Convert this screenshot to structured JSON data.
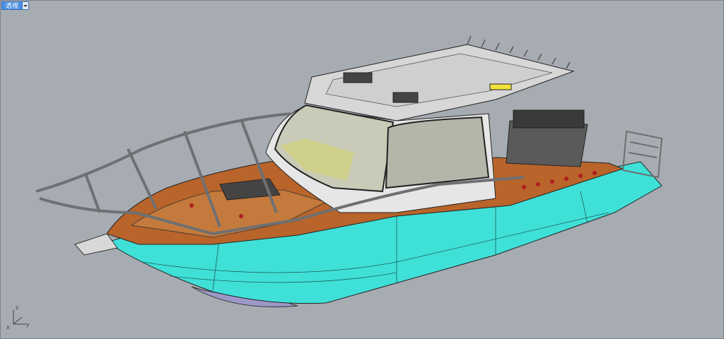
{
  "viewport": {
    "title": "透視",
    "view_menu_icon": "chevron-down-icon"
  },
  "axes": {
    "z": "z",
    "x": "x",
    "y": "y"
  },
  "colors": {
    "background": "#a7acb2",
    "hull": "#3fe0d8",
    "deck": "#b8642a",
    "cabin": "#e6e6e6",
    "glass": "#c9cbb8",
    "rails": "#7d7f82"
  }
}
